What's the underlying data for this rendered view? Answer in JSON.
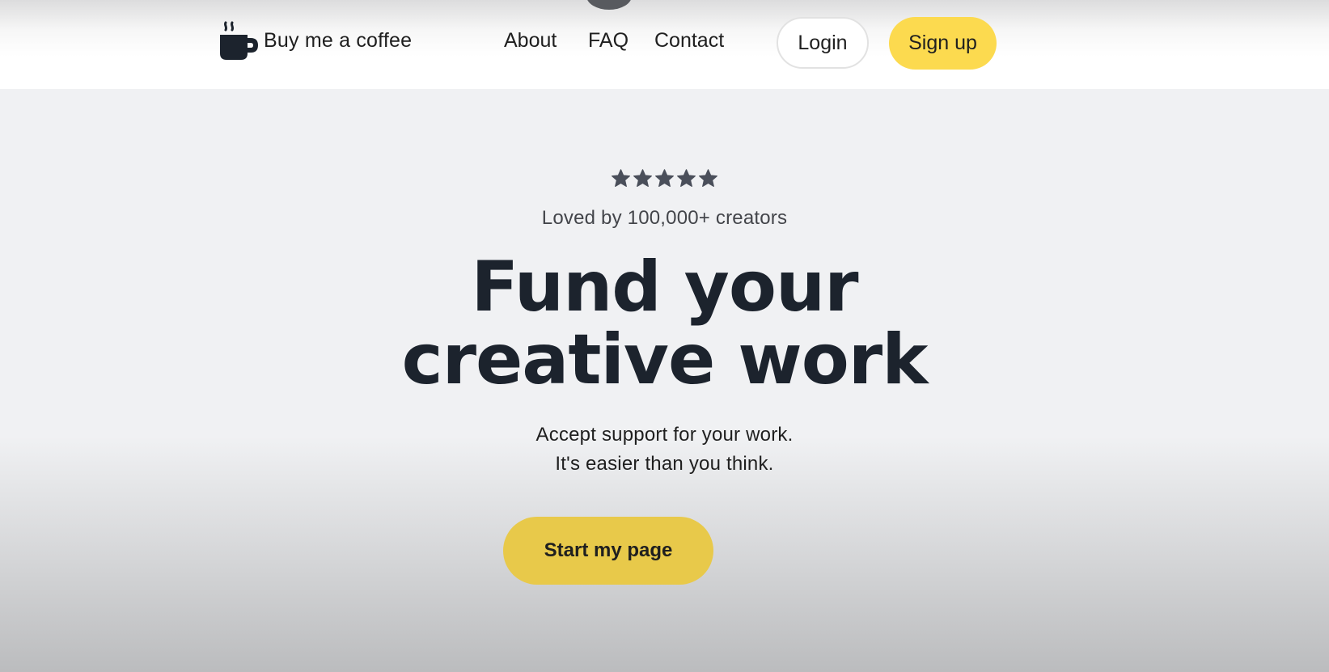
{
  "brand": {
    "name": "Buy me a coffee",
    "logo_icon": "coffee-cup-icon"
  },
  "nav": {
    "links": [
      "About",
      "FAQ",
      "Contact"
    ],
    "login_label": "Login",
    "signup_label": "Sign up"
  },
  "hero": {
    "rating": {
      "stars": 5,
      "max_stars": 5,
      "icon": "star-icon",
      "text": "Loved by 100,000+ creators"
    },
    "headline_line1": "Fund your",
    "headline_line2": "creative work",
    "subtext_line1": "Accept support for your work.",
    "subtext_line2": "It's easier than you think.",
    "cta_label": "Start my page"
  },
  "colors": {
    "accent_yellow": "#fcda4f",
    "cta_yellow": "#e8c94a",
    "text_dark": "#1c232d",
    "star_color": "#4a4f5a"
  }
}
